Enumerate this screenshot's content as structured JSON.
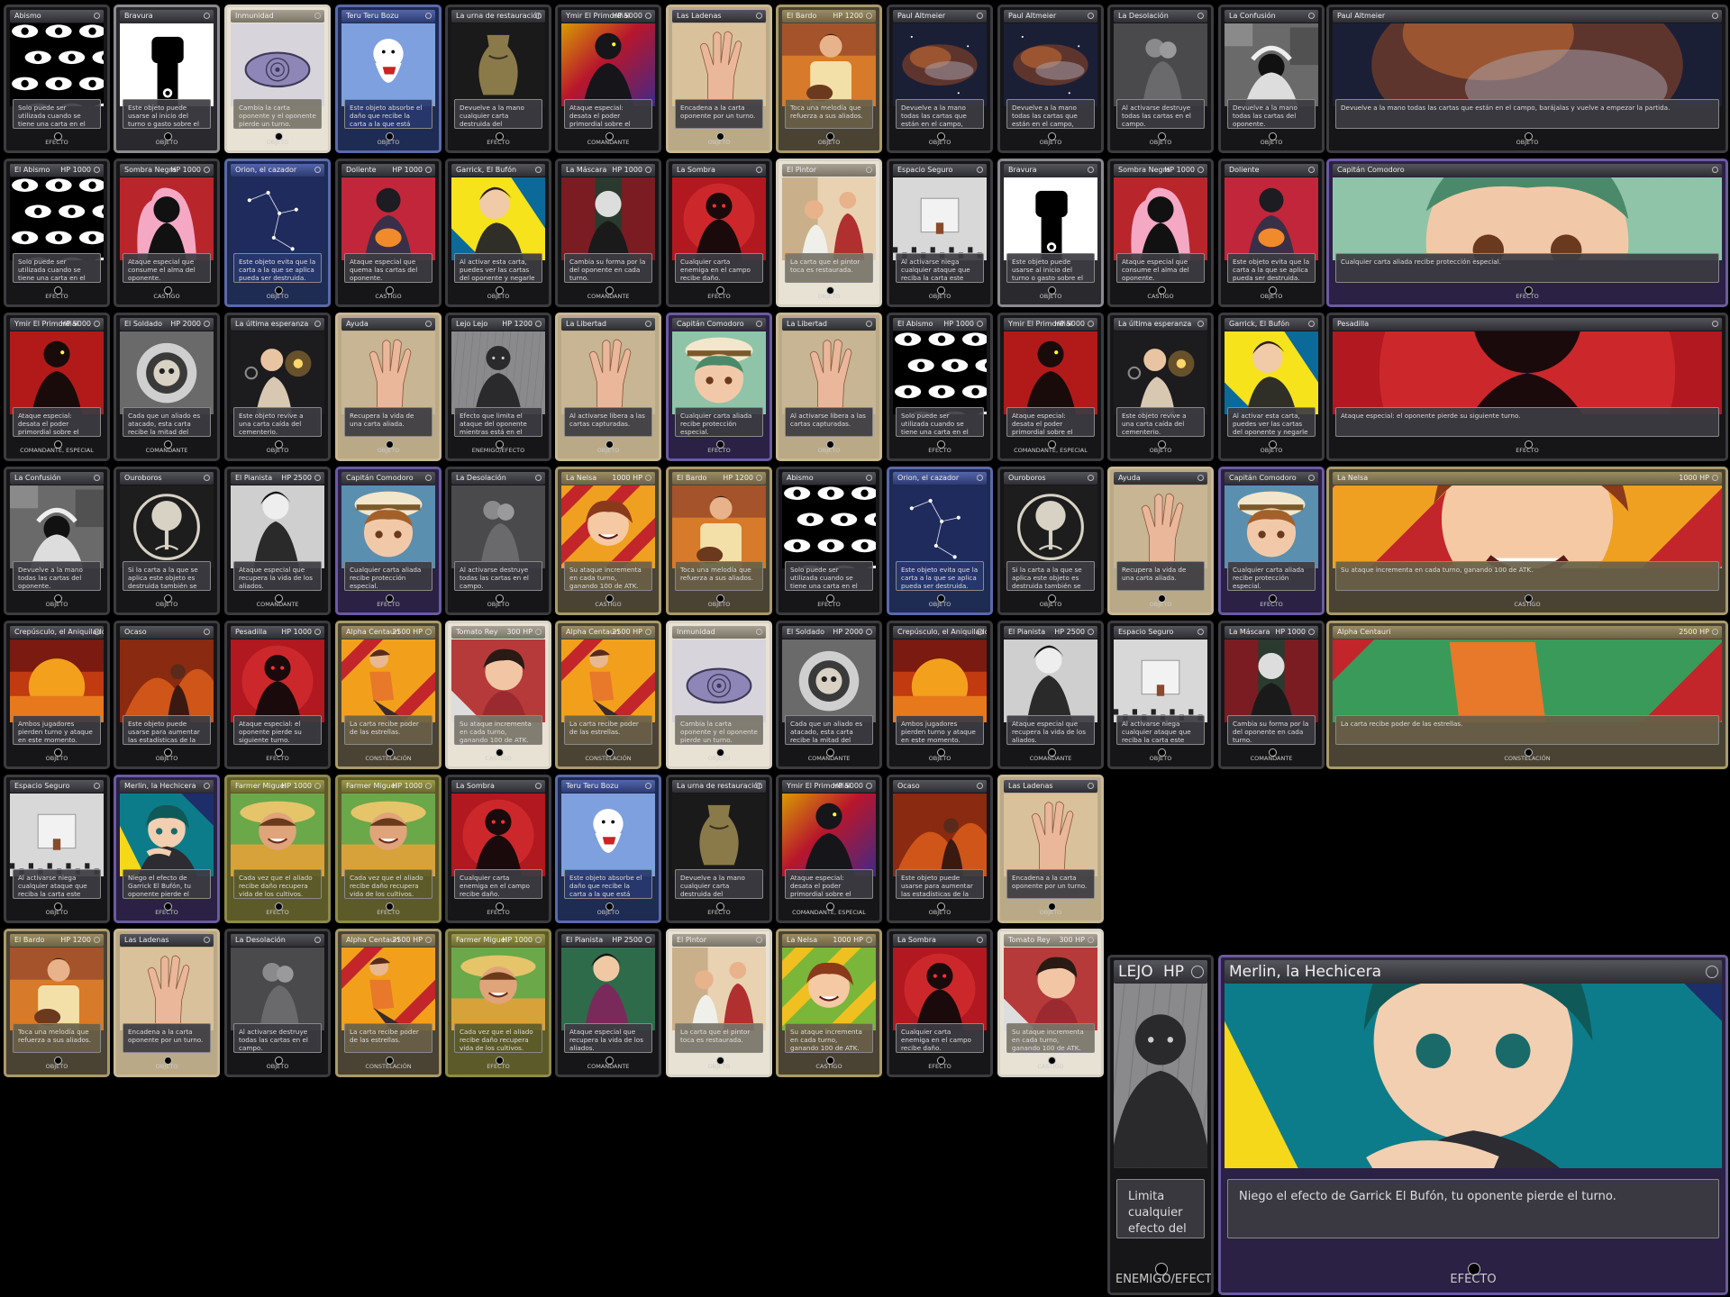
{
  "cards": [
    {
      "title": "Abismo",
      "text": "Solo puede ser utilizada cuando se tiene una carta en el campo.",
      "stats": "",
      "bottom": "EFECTO",
      "art": "eyes",
      "frame": "dark"
    },
    {
      "title": "Bravura",
      "text": "Este objeto puede usarse al inicio del turno o gasto sobre el acción del oponente.",
      "stats": "",
      "bottom": "OBJETO",
      "art": "fist",
      "frame": "silver"
    },
    {
      "title": "Inmunidad",
      "text": "Cambia la carta oponente y el oponente pierde un turno.",
      "stats": "",
      "bottom": "OBJETO",
      "art": "spiral-eye",
      "frame": "white"
    },
    {
      "title": "Teru Teru Bozu",
      "text": "Este objeto absorbe el daño que recibe la carta a la que está aplicado una vez.",
      "stats": "",
      "bottom": "OBJETO",
      "art": "ghost",
      "frame": "blue"
    },
    {
      "title": "La urna de restauración",
      "text": "Devuelve a la mano cualquier carta destruida del cementerio.",
      "stats": "",
      "bottom": "EFECTO",
      "art": "urn",
      "frame": "dark"
    },
    {
      "title": "Ymir El Primordial",
      "text": "Ataque especial: desata el poder primordial sobre el campo.",
      "stats": "HP 5000",
      "bottom": "COMANDANTE",
      "art": "silhouette-rainbow",
      "frame": "dark"
    },
    {
      "title": "Las Ladenas",
      "text": "Encadena a la carta oponente por un turno.",
      "stats": "",
      "bottom": "OBJETO",
      "art": "hand",
      "frame": "cream"
    },
    {
      "title": "El Bardo",
      "text": "Toca una melodía que refuerza a sus aliados.",
      "stats": "HP 1200",
      "bottom": "OBJETO",
      "art": "guitar",
      "frame": "gold"
    },
    {
      "title": "Paul Altmeier",
      "text": "Devuelve a la mano todas las cartas que están en el campo, barájalas y vuelve a empezar la partida.",
      "stats": "",
      "bottom": "OBJETO",
      "art": "nebula",
      "frame": "dark"
    },
    {
      "title": "Paul Altmeier",
      "text": "Devuelve a la mano todas las cartas que están en el campo, barájalas y vuelve a empezar la partida.",
      "stats": "",
      "bottom": "OBJETO",
      "art": "nebula",
      "frame": "dark"
    },
    {
      "title": "La Desolación",
      "text": "Al activarse destruye todas las cartas en el campo.",
      "stats": "",
      "bottom": "OBJETO",
      "art": "rain-couple",
      "frame": "dark"
    },
    {
      "title": "La Confusión",
      "text": "Devuelve a la mano todas las cartas del oponente.",
      "stats": "",
      "bottom": "OBJETO",
      "art": "confusion",
      "frame": "dark"
    },
    {
      "title": "Paul Altmeier",
      "text": "Devuelve a la mano todas las cartas que están en el campo, barájalas y vuelve a empezar la partida.",
      "stats": "",
      "bottom": "OBJETO",
      "art": "nebula",
      "frame": "dark"
    },
    {
      "title": "El Abismo",
      "text": "Solo puede ser utilizada cuando se tiene una carta en el campo.",
      "stats": "HP 1000",
      "bottom": "EFECTO",
      "art": "eyes",
      "frame": "dark"
    },
    {
      "title": "Sombra Negra",
      "text": "Ataque especial que consume el alma del oponente.",
      "stats": "HP 1000",
      "bottom": "CASTIGO",
      "art": "pink-shadow",
      "frame": "dark"
    },
    {
      "title": "Orion, el cazador",
      "text": "Este objeto evita que la carta a la que se aplica pueda ser destruida.",
      "stats": "",
      "bottom": "OBJETO",
      "art": "constellation",
      "frame": "blue"
    },
    {
      "title": "Doliente",
      "text": "Ataque especial que quema las cartas del oponente.",
      "stats": "HP 1000",
      "bottom": "CASTIGO",
      "art": "red-silhouette",
      "frame": "dark"
    },
    {
      "title": "Garrick, El Bufón",
      "text": "Al activar esta carta, puedes ver las cartas del oponente y negarle el siguiente turno.",
      "stats": "",
      "bottom": "OBJETO",
      "art": "jester",
      "frame": "dark"
    },
    {
      "title": "La Máscara",
      "text": "Cambia su forma por la del oponente en cada turno.",
      "stats": "HP 1000",
      "bottom": "COMANDANTE",
      "art": "mask",
      "frame": "dark"
    },
    {
      "title": "La Sombra",
      "text": "Cualquier carta enemiga en el campo recibe daño.",
      "stats": "",
      "bottom": "EFECTO",
      "art": "red-shadow",
      "frame": "dark"
    },
    {
      "title": "El Pintor",
      "text": "La carta que el pintor toca es restaurada.",
      "stats": "",
      "bottom": "OBJETO",
      "art": "painter",
      "frame": "white"
    },
    {
      "title": "Espacio Seguro",
      "text": "Al activarse niega cualquier ataque que reciba la carta este turno.",
      "stats": "",
      "bottom": "OBJETO",
      "art": "room",
      "frame": "dark"
    },
    {
      "title": "Bravura",
      "text": "Este objeto puede usarse al inicio del turno o gasto sobre el acción del oponente.",
      "stats": "",
      "bottom": "OBJETO",
      "art": "fist",
      "frame": "silver"
    },
    {
      "title": "Sombra Negra",
      "text": "Ataque especial que consume el alma del oponente.",
      "stats": "HP 1000",
      "bottom": "CASTIGO",
      "art": "pink-shadow",
      "frame": "dark"
    },
    {
      "title": "Doliente",
      "text": "Este objeto evita que la carta a la que se aplica pueda ser destruida.",
      "stats": "",
      "bottom": "OBJETO",
      "art": "red-silhouette",
      "frame": "dark"
    },
    {
      "title": "Capitán Comodoro",
      "text": "Cualquier carta aliada recibe protección especial.",
      "stats": "",
      "bottom": "EFECTO",
      "art": "captain",
      "frame": "purple"
    },
    {
      "title": "Ymir El Primordial",
      "text": "Ataque especial: desata el poder primordial sobre el campo.",
      "stats": "HP 5000",
      "bottom": "COMANDANTE, ESPECIAL",
      "art": "ymir-red",
      "frame": "dark"
    },
    {
      "title": "El Soldado",
      "text": "Cada que un aliado es atacado, esta carta recibe la mitad del daño.",
      "stats": "HP 2000",
      "bottom": "COMANDANTE",
      "art": "astronaut",
      "frame": "dark"
    },
    {
      "title": "La última esperanza",
      "text": "Este objeto revive a una carta caída del cementerio.",
      "stats": "",
      "bottom": "OBJETO",
      "art": "lantern",
      "frame": "dark"
    },
    {
      "title": "Ayuda",
      "text": "Recupera la vida de una carta aliada.",
      "stats": "",
      "bottom": "OBJETO",
      "art": "hand-beige",
      "frame": "cream"
    },
    {
      "title": "Lejo Lejo",
      "text": "Efecto que limita el ataque del oponente mientras está en el campo.",
      "stats": "HP 1200",
      "bottom": "ENEMIGO/EFECTO",
      "art": "ghost-figure",
      "frame": "dark"
    },
    {
      "title": "La Libertad",
      "text": "Al activarse libera a las cartas capturadas.",
      "stats": "",
      "bottom": "OBJETO",
      "art": "hand-beige",
      "frame": "cream"
    },
    {
      "title": "Capitán Comodoro",
      "text": "Cualquier carta aliada recibe protección especial.",
      "stats": "",
      "bottom": "EFECTO",
      "art": "captain",
      "frame": "purple"
    },
    {
      "title": "La Libertad",
      "text": "Al activarse libera a las cartas capturadas.",
      "stats": "",
      "bottom": "OBJETO",
      "art": "hand-beige",
      "frame": "cream"
    },
    {
      "title": "El Abismo",
      "text": "Solo puede ser utilizada cuando se tiene una carta en el campo.",
      "stats": "HP 1000",
      "bottom": "EFECTO",
      "art": "eyes",
      "frame": "dark"
    },
    {
      "title": "Ymir El Primordial",
      "text": "Ataque especial: desata el poder primordial sobre el campo.",
      "stats": "HP 5000",
      "bottom": "COMANDANTE, ESPECIAL",
      "art": "ymir-red",
      "frame": "dark"
    },
    {
      "title": "La última esperanza",
      "text": "Este objeto revive a una carta caída del cementerio.",
      "stats": "",
      "bottom": "OBJETO",
      "art": "lantern",
      "frame": "dark"
    },
    {
      "title": "Garrick, El Bufón",
      "text": "Al activar esta carta, puedes ver las cartas del oponente y negarle el siguiente turno.",
      "stats": "",
      "bottom": "OBJETO",
      "art": "jester",
      "frame": "dark"
    },
    {
      "title": "Pesadilla",
      "text": "Ataque especial: el oponente pierde su siguiente turno.",
      "stats": "",
      "bottom": "EFECTO",
      "art": "red-shadow",
      "frame": "dark"
    },
    {
      "title": "La Confusión",
      "text": "Devuelve a la mano todas las cartas del oponente.",
      "stats": "",
      "bottom": "OBJETO",
      "art": "confusion",
      "frame": "dark"
    },
    {
      "title": "Ouroboros",
      "text": "Si la carta a la que se aplica este objeto es destruida también se destruye la carta atacante.",
      "stats": "",
      "bottom": "OBJETO",
      "art": "tree",
      "frame": "dark"
    },
    {
      "title": "El Pianista",
      "text": "Ataque especial que recupera la vida de los aliados.",
      "stats": "HP 2500",
      "bottom": "COMANDANTE",
      "art": "sitting-boy",
      "frame": "dark"
    },
    {
      "title": "Capitán Comodoro",
      "text": "Cualquier carta aliada recibe protección especial.",
      "stats": "",
      "bottom": "EFECTO",
      "art": "captain-orange",
      "frame": "purple"
    },
    {
      "title": "La Desolación",
      "text": "Al activarse destruye todas las cartas en el campo.",
      "stats": "",
      "bottom": "OBJETO",
      "art": "rain-couple",
      "frame": "dark"
    },
    {
      "title": "La Nelsa",
      "text": "Su ataque incrementa en cada turno, ganando 100 de ATK.",
      "stats": "1000 HP",
      "bottom": "CASTIGO",
      "art": "nelsa",
      "frame": "gold"
    },
    {
      "title": "El Bardo",
      "text": "Toca una melodía que refuerza a sus aliados.",
      "stats": "HP 1200",
      "bottom": "OBJETO",
      "art": "guitar",
      "frame": "gold"
    },
    {
      "title": "Abismo",
      "text": "Solo puede ser utilizada cuando se tiene una carta en el campo.",
      "stats": "",
      "bottom": "EFECTO",
      "art": "eyes",
      "frame": "dark"
    },
    {
      "title": "Orion, el cazador",
      "text": "Este objeto evita que la carta a la que se aplica pueda ser destruida.",
      "stats": "",
      "bottom": "OBJETO",
      "art": "constellation",
      "frame": "blue"
    },
    {
      "title": "Ouroboros",
      "text": "Si la carta a la que se aplica este objeto es destruida también se destruye la carta atacante.",
      "stats": "",
      "bottom": "OBJETO",
      "art": "tree",
      "frame": "dark"
    },
    {
      "title": "Ayuda",
      "text": "Recupera la vida de una carta aliada.",
      "stats": "",
      "bottom": "OBJETO",
      "art": "hand-beige",
      "frame": "cream"
    },
    {
      "title": "Capitán Comodoro",
      "text": "Cualquier carta aliada recibe protección especial.",
      "stats": "",
      "bottom": "EFECTO",
      "art": "captain-orange",
      "frame": "purple"
    },
    {
      "title": "La Nelsa",
      "text": "Su ataque incrementa en cada turno, ganando 100 de ATK.",
      "stats": "1000 HP",
      "bottom": "CASTIGO",
      "art": "nelsa",
      "frame": "gold"
    },
    {
      "title": "Crepúsculo, el Aniquilador",
      "text": "Ambos jugadores pierden turno y ataque en este momento.",
      "stats": "",
      "bottom": "OBJETO",
      "art": "sunset",
      "frame": "dark"
    },
    {
      "title": "Ocaso",
      "text": "Este objeto puede usarse para aumentar las estadísticas de la carta a la que se aplica.",
      "stats": "",
      "bottom": "OBJETO",
      "art": "fire-girl",
      "frame": "dark"
    },
    {
      "title": "Pesadilla",
      "text": "Ataque especial: el oponente pierde su siguiente turno.",
      "stats": "HP 1000",
      "bottom": "EFECTO",
      "art": "red-shadow",
      "frame": "dark"
    },
    {
      "title": "Alpha Centauri",
      "text": "La carta recibe poder de las estrellas.",
      "stats": "2500 HP",
      "bottom": "CONSTELACIÓN",
      "art": "centauri",
      "frame": "gold"
    },
    {
      "title": "Tomato Rey",
      "text": "Su ataque incrementa en cada turno, ganando 100 de ATK.",
      "stats": "300 HP",
      "bottom": "CASTIGO",
      "art": "tomato",
      "frame": "white"
    },
    {
      "title": "Alpha Centauri",
      "text": "La carta recibe poder de las estrellas.",
      "stats": "2500 HP",
      "bottom": "CONSTELACIÓN",
      "art": "centauri",
      "frame": "gold"
    },
    {
      "title": "Inmunidad",
      "text": "Cambia la carta oponente y el oponente pierde un turno.",
      "stats": "",
      "bottom": "OBJETO",
      "art": "spiral-eye",
      "frame": "white"
    },
    {
      "title": "El Soldado",
      "text": "Cada que un aliado es atacado, esta carta recibe la mitad del daño.",
      "stats": "HP 2000",
      "bottom": "COMANDANTE",
      "art": "astronaut",
      "frame": "dark"
    },
    {
      "title": "Crepúsculo, el Aniquilador",
      "text": "Ambos jugadores pierden turno y ataque en este momento.",
      "stats": "",
      "bottom": "OBJETO",
      "art": "sunset",
      "frame": "dark"
    },
    {
      "title": "El Pianista",
      "text": "Ataque especial que recupera la vida de los aliados.",
      "stats": "HP 2500",
      "bottom": "COMANDANTE",
      "art": "sitting-boy",
      "frame": "dark"
    },
    {
      "title": "Espacio Seguro",
      "text": "Al activarse niega cualquier ataque que reciba la carta este turno.",
      "stats": "",
      "bottom": "OBJETO",
      "art": "room",
      "frame": "dark"
    },
    {
      "title": "La Máscara",
      "text": "Cambia su forma por la del oponente en cada turno.",
      "stats": "HP 1000",
      "bottom": "COMANDANTE",
      "art": "mask",
      "frame": "dark"
    },
    {
      "title": "Alpha Centauri",
      "text": "La carta recibe poder de las estrellas.",
      "stats": "2500 HP",
      "bottom": "CONSTELACIÓN",
      "art": "centauri-green",
      "frame": "gold"
    },
    {
      "title": "Espacio Seguro",
      "text": "Al activarse niega cualquier ataque que reciba la carta este turno.",
      "stats": "",
      "bottom": "OBJETO",
      "art": "room",
      "frame": "dark"
    },
    {
      "title": "Merlin, la Hechicera",
      "text": "Niego el efecto de Garrick El Bufón, tu oponente pierde el turno.",
      "stats": "",
      "bottom": "EFECTO",
      "art": "merlin",
      "frame": "purple"
    },
    {
      "title": "Farmer Miguel",
      "text": "Cada vez que el aliado recibe daño recupera vida de los cultivos.",
      "stats": "HP 1000",
      "bottom": "EFECTO",
      "art": "farmer",
      "frame": "olive"
    },
    {
      "title": "Farmer Miguel",
      "text": "Cada vez que el aliado recibe daño recupera vida de los cultivos.",
      "stats": "HP 1000",
      "bottom": "EFECTO",
      "art": "farmer",
      "frame": "olive"
    },
    {
      "title": "La Sombra",
      "text": "Cualquier carta enemiga en el campo recibe daño.",
      "stats": "",
      "bottom": "EFECTO",
      "art": "red-shadow",
      "frame": "dark"
    },
    {
      "title": "Teru Teru Bozu",
      "text": "Este objeto absorbe el daño que recibe la carta a la que está aplicado una vez.",
      "stats": "",
      "bottom": "OBJETO",
      "art": "ghost",
      "frame": "blue"
    },
    {
      "title": "La urna de restauración",
      "text": "Devuelve a la mano cualquier carta destruida del cementerio.",
      "stats": "",
      "bottom": "EFECTO",
      "art": "urn",
      "frame": "dark"
    },
    {
      "title": "Ymir El Primordial",
      "text": "Ataque especial: desata el poder primordial sobre el campo.",
      "stats": "HP 5000",
      "bottom": "COMANDANTE, ESPECIAL",
      "art": "silhouette-rainbow",
      "frame": "dark"
    },
    {
      "title": "Ocaso",
      "text": "Este objeto puede usarse para aumentar las estadísticas de la carta a la que se aplica.",
      "stats": "",
      "bottom": "OBJETO",
      "art": "fire-girl",
      "frame": "dark"
    },
    {
      "title": "Las Ladenas",
      "text": "Encadena a la carta oponente por un turno.",
      "stats": "",
      "bottom": "OBJETO",
      "art": "hand",
      "frame": "cream"
    },
    {
      "title": "El Bardo",
      "text": "Toca una melodía que refuerza a sus aliados.",
      "stats": "HP 1200",
      "bottom": "OBJETO",
      "art": "guitar",
      "frame": "gold"
    },
    {
      "title": "Las Ladenas",
      "text": "Encadena a la carta oponente por un turno.",
      "stats": "",
      "bottom": "OBJETO",
      "art": "hand",
      "frame": "cream"
    },
    {
      "title": "La Desolación",
      "text": "Al activarse destruye todas las cartas en el campo.",
      "stats": "",
      "bottom": "OBJETO",
      "art": "rain-couple",
      "frame": "dark"
    },
    {
      "title": "Alpha Centauri",
      "text": "La carta recibe poder de las estrellas.",
      "stats": "2500 HP",
      "bottom": "CONSTELACIÓN",
      "art": "centauri",
      "frame": "gold"
    },
    {
      "title": "Farmer Miguel",
      "text": "Cada vez que el aliado recibe daño recupera vida de los cultivos.",
      "stats": "HP 1000",
      "bottom": "EFECTO",
      "art": "farmer",
      "frame": "olive"
    },
    {
      "title": "El Pianista",
      "text": "Ataque especial que recupera la vida de los aliados.",
      "stats": "HP 2500",
      "bottom": "COMANDANTE",
      "art": "sitting-rainbow",
      "frame": "dark"
    },
    {
      "title": "El Pintor",
      "text": "La carta que el pintor toca es restaurada.",
      "stats": "",
      "bottom": "OBJETO",
      "art": "painter",
      "frame": "white"
    },
    {
      "title": "La Nelsa",
      "text": "Su ataque incrementa en cada turno, ganando 100 de ATK.",
      "stats": "1000 HP",
      "bottom": "CASTIGO",
      "art": "nelsa-green",
      "frame": "gold"
    },
    {
      "title": "La Sombra",
      "text": "Cualquier carta enemiga en el campo recibe daño.",
      "stats": "",
      "bottom": "EFECTO",
      "art": "red-shadow",
      "frame": "dark"
    },
    {
      "title": "Tomato Rey",
      "text": "Su ataque incrementa en cada turno, ganando 100 de ATK.",
      "stats": "300 HP",
      "bottom": "CASTIGO",
      "art": "tomato",
      "frame": "white"
    }
  ],
  "big_cards": [
    {
      "title": "LEJO",
      "stats": "HP",
      "text": "Limita cualquier efecto del oponente mientras este en el campo.",
      "bottom": "ENEMIGO/EFECTO",
      "art": "ghost-figure-big",
      "frame": "dark"
    },
    {
      "title": "Merlin, la Hechicera",
      "stats": "",
      "text": "Niego el efecto de Garrick El Bufón, tu oponente pierde el turno.",
      "bottom": "EFECTO",
      "art": "merlin-big",
      "frame": "purple"
    }
  ]
}
